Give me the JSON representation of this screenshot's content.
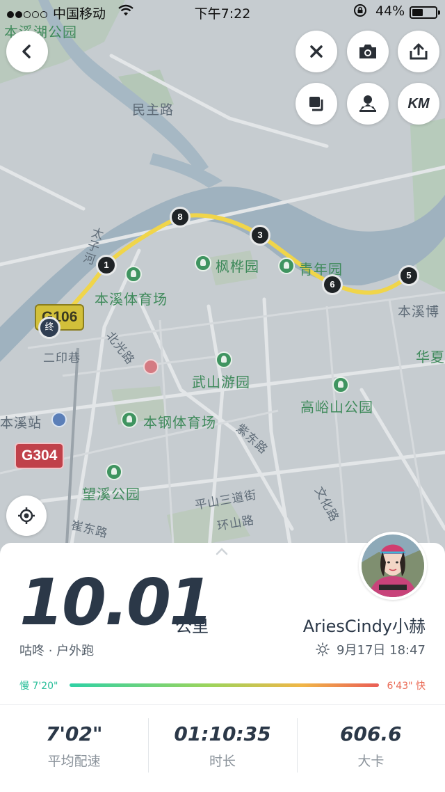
{
  "status_bar": {
    "carrier": "中国移动",
    "time": "下午7:22",
    "battery": "44%",
    "signal_icon": "signal-dots-icon",
    "wifi_icon": "wifi-icon",
    "rotation_lock_icon": "rotation-lock-icon",
    "battery_icon": "battery-icon"
  },
  "map": {
    "labels": {
      "benxi_lake_park": "本溪湖公园",
      "minzhu_road": "民主路",
      "taizi_river": "太子河",
      "fenghua_park": "枫桦园",
      "youth_park": "青年园",
      "benxi_stadium": "本溪体育场",
      "benxi_museum": "本溪博",
      "huaxia": "华夏",
      "beiguang_road": "北光路",
      "eryin_lane": "二印巷",
      "wushan_park": "武山游园",
      "gaoyu_park": "高峪山公园",
      "benxi_station": "本溪站",
      "bengang_stadium": "本钢体育场",
      "zidong_road": "紫东路",
      "wangxi_park": "望溪公园",
      "pingshan_street": "平山三道街",
      "cuidong_road": "崔东路",
      "huanshan_road": "环山路",
      "wenhua_road": "文化路"
    },
    "shields": {
      "g106": "G106",
      "g304": "G304"
    },
    "km_markers": [
      "1",
      "8",
      "3",
      "6",
      "5"
    ],
    "end_marker": "终",
    "route_color": "#f0d54a"
  },
  "controls": {
    "back_icon": "chevron-left-icon",
    "close_icon": "close-icon",
    "camera_icon": "camera-icon",
    "share_icon": "share-icon",
    "layers_icon": "layers-icon",
    "pin_icon": "person-pin-icon",
    "km_label": "KM",
    "locate_icon": "locate-icon"
  },
  "summary": {
    "distance": "10.01",
    "unit": "公里",
    "activity": "咕咚 · 户外跑",
    "username": "AriesCindy小赫",
    "weather_icon": "sun-icon",
    "datetime": "9月17日 18:47",
    "pace_slow": "慢 7'20\"",
    "pace_fast": "6'43\" 快"
  },
  "stats": [
    {
      "value": "7'02\"",
      "label": "平均配速"
    },
    {
      "value": "01:10:35",
      "label": "时长"
    },
    {
      "value": "606.6",
      "label": "大卡"
    }
  ]
}
